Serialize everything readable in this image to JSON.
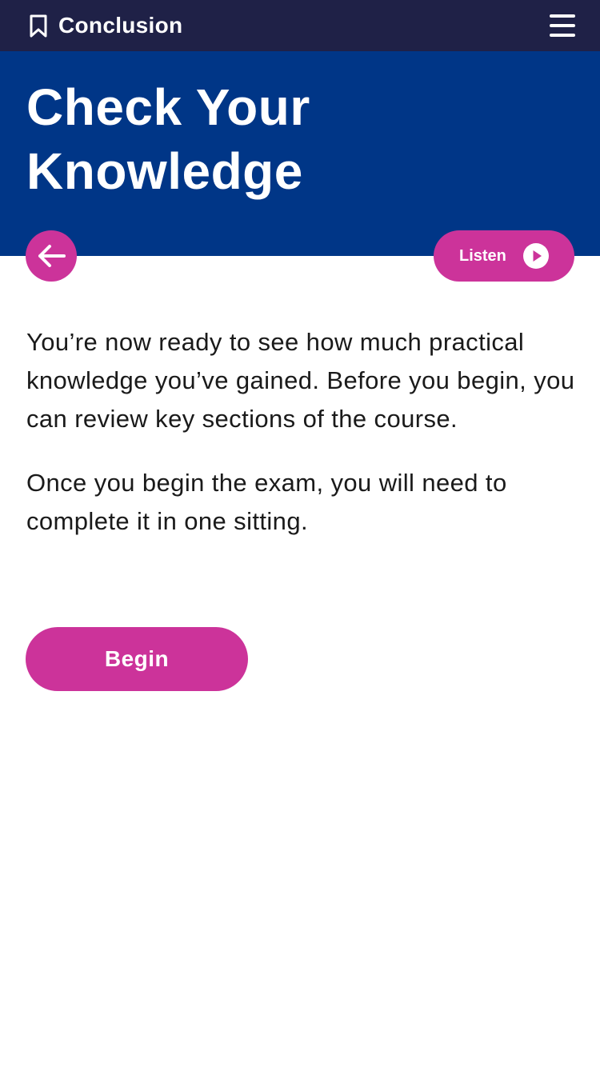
{
  "header": {
    "section_title": "Conclusion",
    "bookmark_icon": "bookmark-icon",
    "menu_icon": "hamburger-menu-icon"
  },
  "hero": {
    "title": "Check Your Knowledge"
  },
  "controls": {
    "back_icon": "arrow-left-icon",
    "listen_label": "Listen",
    "listen_icon": "play-icon"
  },
  "content": {
    "paragraphs": [
      "You’re now ready to see how much practical knowledge you’ve gained. Before you begin, you can review key sections of the course.",
      "Once you begin the exam, you will need to complete it in one sitting."
    ],
    "begin_label": "Begin"
  },
  "colors": {
    "header_bg": "#1f2147",
    "hero_bg": "#003687",
    "accent": "#cc339a",
    "text": "#1a1a1a"
  }
}
